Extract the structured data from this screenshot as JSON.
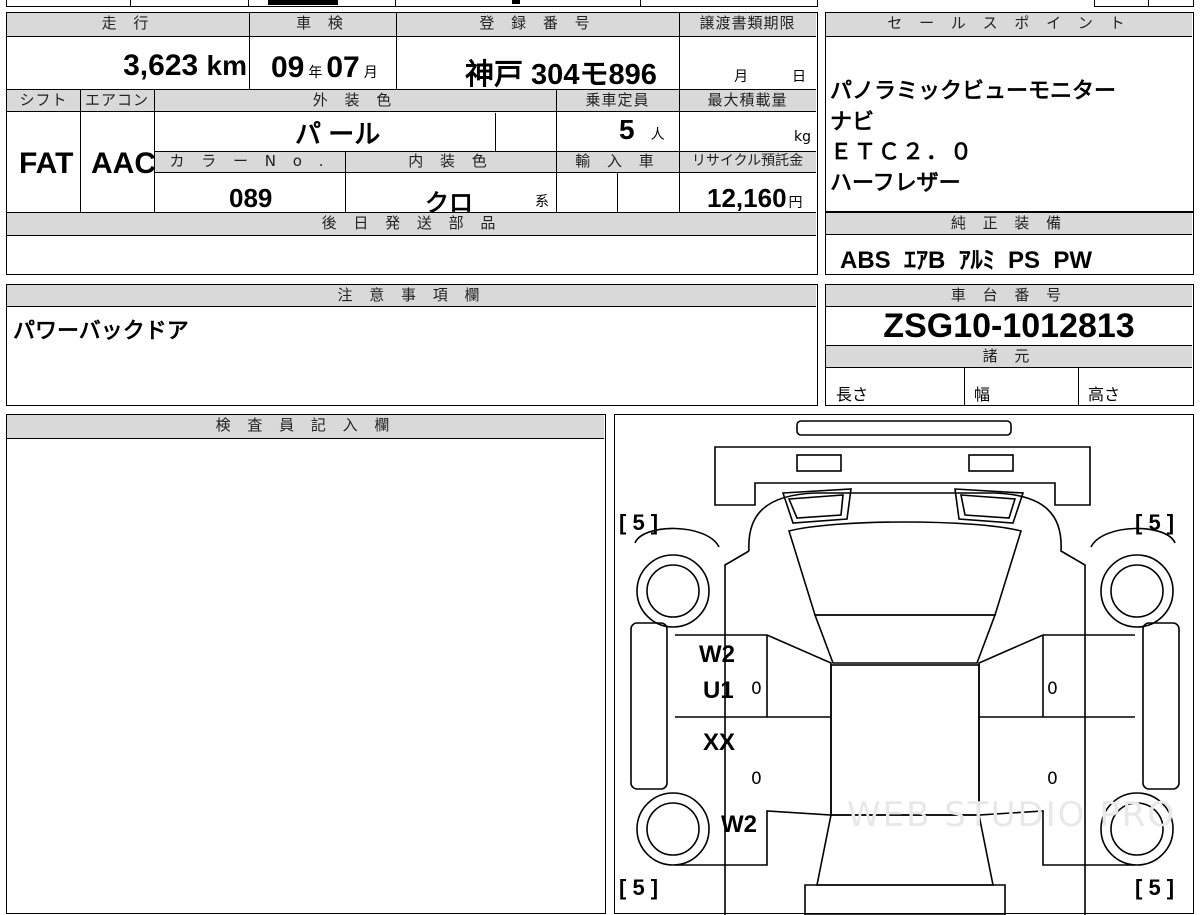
{
  "vehicle_info": {
    "headers": {
      "mileage": "走 行",
      "inspection": "車 検",
      "registration": "登 録 番 号",
      "transfer_deadline": "譲渡書類期限",
      "shift": "シフト",
      "aircon": "エアコン",
      "exterior_color": "外 装 色",
      "capacity": "乗車定員",
      "max_load": "最大積載量",
      "color_no": "カ ラ ー N o .",
      "interior_color": "内 装 色",
      "import": "輸 入 車",
      "recycle": "リサイクル預託金",
      "later_parts": "後 日 発 送 部 品"
    },
    "mileage": {
      "value": "3,623",
      "unit": "km"
    },
    "inspection": {
      "year": "09",
      "year_unit": "年",
      "month": "07",
      "month_unit": "月"
    },
    "registration_number": "神戸 304モ896",
    "transfer_deadline": {
      "month_unit": "月",
      "day_unit": "日"
    },
    "shift": "FAT",
    "aircon": "AAC",
    "exterior_color": "パ ール",
    "capacity": {
      "value": "5",
      "unit": "人"
    },
    "max_load_unit": "kg",
    "color_no": "089",
    "interior_color": {
      "value": "クロ",
      "suffix": "系"
    },
    "recycle_fee": {
      "value": "12,160",
      "unit": "円"
    }
  },
  "sales_points": {
    "header": "セ ー ル ス ポ イ ン ト",
    "items": [
      "パノラミックビューモニター",
      "ナビ",
      "ＥＴＣ２．０",
      "ハーフレザー"
    ]
  },
  "standard_equipment": {
    "header": "純 正 装 備",
    "value": "ABS  ｴｱB  ｱﾙﾐ  PS  PW"
  },
  "notes": {
    "header": "注 意 事 項 欄",
    "text": "パワーバックドア"
  },
  "chassis": {
    "header": "車 台 番 号",
    "number": "ZSG10-1012813",
    "specs_header": "諸 元",
    "length_label": "長さ",
    "width_label": "幅",
    "height_label": "高さ"
  },
  "inspector": {
    "header": "検 査 員 記 入 欄"
  },
  "diagram": {
    "tire_marks": {
      "front_left": "[ 5 ]",
      "front_right": "[ 5 ]",
      "rear_left": "[ 5 ]",
      "rear_right": "[ 5 ]"
    },
    "damage": {
      "front_left_door": "W2",
      "front_left_door_2": "U1",
      "rear_left_door": "XX",
      "rear_left_fender": "W2"
    },
    "zero_marks": [
      "0",
      "0",
      "0",
      "0"
    ],
    "watermark": "WEB STUDIO PRO"
  }
}
